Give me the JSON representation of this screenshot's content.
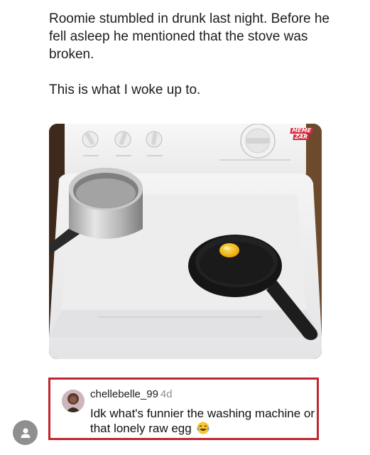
{
  "post": {
    "line1": "Roomie stumbled in drunk last night. Before he fell asleep he mentioned that the stove was broken.",
    "line2": "This is what I woke up to."
  },
  "image": {
    "watermark_top": "MEME",
    "watermark_bottom": "ZAR"
  },
  "comment": {
    "username": "chellebelle_99",
    "time": "4d",
    "text": "Idk what's funnier the washing machine or that lonely raw egg",
    "emoji": "laughing-crying-emoji"
  },
  "icons": {
    "profile": "person-icon"
  },
  "colors": {
    "highlight_border": "#c0262d",
    "timestamp": "#8e8e8e",
    "fab": "#8f8f8f"
  }
}
